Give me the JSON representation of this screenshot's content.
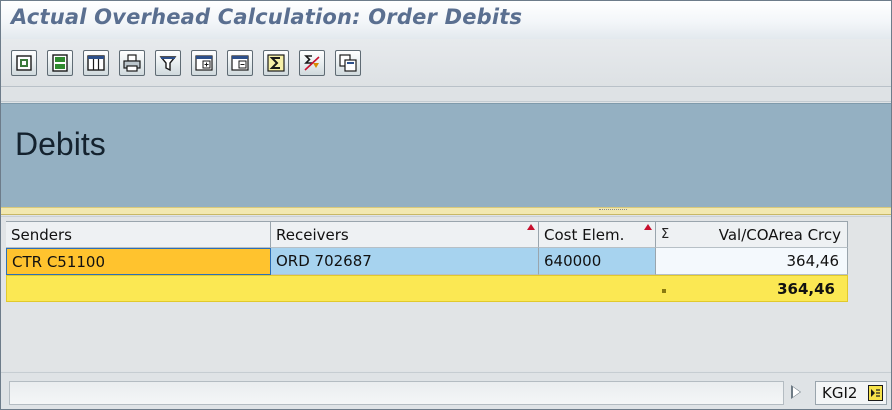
{
  "window": {
    "title": "Actual Overhead Calculation: Order Debits"
  },
  "toolbar": {
    "buttons": [
      {
        "name": "details-icon"
      },
      {
        "name": "select-all-icon"
      },
      {
        "name": "choose-layout-icon"
      },
      {
        "name": "print-icon"
      },
      {
        "name": "filter-icon"
      },
      {
        "name": "expand-icon"
      },
      {
        "name": "collapse-icon"
      },
      {
        "name": "total-icon"
      },
      {
        "name": "subtotal-icon"
      },
      {
        "name": "export-icon"
      }
    ]
  },
  "header": {
    "title": "Debits"
  },
  "grid": {
    "columns": [
      {
        "label": "Senders",
        "sort_marker": false
      },
      {
        "label": "Receivers",
        "sort_marker": true
      },
      {
        "label": "Cost Elem.",
        "sort_marker": true
      },
      {
        "label": "Val/COArea Crcy",
        "sort_marker": false,
        "sigma": "Σ"
      }
    ],
    "rows": [
      {
        "senders": "CTR C51100",
        "receivers": "ORD 702687",
        "cost_element": "640000",
        "value": "364,46"
      }
    ],
    "total": {
      "value": "364,46"
    }
  },
  "status": {
    "system_code": "KGI2"
  },
  "colors": {
    "title_text": "#5a6f90",
    "header_panel": "#94b0c2",
    "sender_cell": "#ffc32e",
    "selected_cells": "#a7d3ef",
    "total_row": "#fbe853"
  }
}
